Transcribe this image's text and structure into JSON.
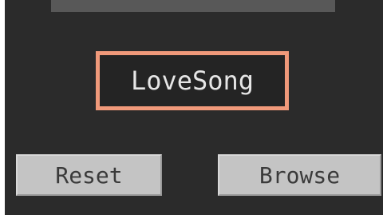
{
  "name_field": {
    "value": "LoveSong"
  },
  "buttons": {
    "reset_label": "Reset",
    "browse_label": "Browse"
  },
  "colors": {
    "panel_background": "#2b2b2b",
    "highlight_border": "#f0997a",
    "button_face": "#c4c4c4"
  }
}
